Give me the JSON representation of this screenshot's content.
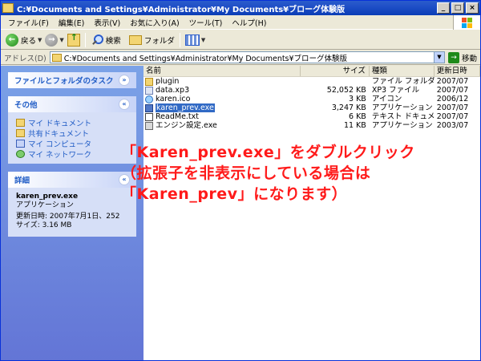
{
  "window": {
    "title": "C:¥Documents and Settings¥Administrator¥My Documents¥ブローグ体験版"
  },
  "menu": [
    "ファイル(F)",
    "編集(E)",
    "表示(V)",
    "お気に入り(A)",
    "ツール(T)",
    "ヘルプ(H)"
  ],
  "toolbar": {
    "back": "戻る",
    "search": "検索",
    "folders": "フォルダ"
  },
  "address": {
    "label": "アドレス(D)",
    "path": "C:¥Documents and Settings¥Administrator¥My Documents¥ブローグ体験版",
    "go": "移動"
  },
  "tasks": {
    "file_folder_tasks": "ファイルとフォルダのタスク",
    "other": {
      "title": "その他",
      "items": [
        "マイ ドキュメント",
        "共有ドキュメント",
        "マイ コンピュータ",
        "マイ ネットワーク"
      ]
    },
    "details": {
      "title": "詳細",
      "name": "karen_prev.exe",
      "type": "アプリケーション",
      "modified": "更新日時: 2007年7月1日、252",
      "size": "サイズ: 3.16 MB"
    }
  },
  "columns": {
    "name": "名前",
    "size": "サイズ",
    "type": "種類",
    "date": "更新日時"
  },
  "files": [
    {
      "name": "plugin",
      "size": "",
      "type": "ファイル フォルダ",
      "date": "2007/07",
      "icon": "folder-icon"
    },
    {
      "name": "data.xp3",
      "size": "52,052 KB",
      "type": "XP3 ファイル",
      "date": "2007/07",
      "icon": "document-icon"
    },
    {
      "name": "karen.ico",
      "size": "3 KB",
      "type": "アイコン",
      "date": "2006/12",
      "icon": "icon-file-icon"
    },
    {
      "name": "karen_prev.exe",
      "size": "3,247 KB",
      "type": "アプリケーション",
      "date": "2007/07",
      "icon": "exe-icon"
    },
    {
      "name": "ReadMe.txt",
      "size": "6 KB",
      "type": "テキスト ドキュメント",
      "date": "2007/07",
      "icon": "text-file-icon"
    },
    {
      "name": "エンジン設定.exe",
      "size": "11 KB",
      "type": "アプリケーション",
      "date": "2003/07",
      "icon": "settings-exe-icon"
    }
  ],
  "selected_file": "karen_prev.exe",
  "annotation": {
    "line1": "「Karen_prev.exe」をダブルクリック",
    "line2": "（拡張子を非表示にしている場合は",
    "line3": "「Karen_prev」になります）",
    "color": "#ff1a1a"
  }
}
